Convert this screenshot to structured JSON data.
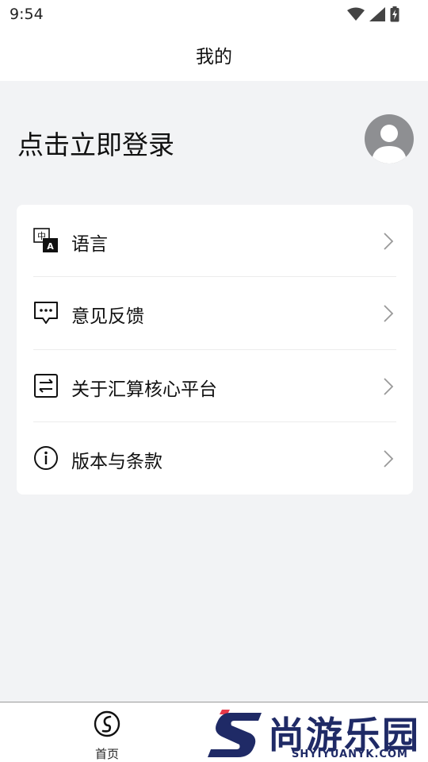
{
  "status_bar": {
    "time": "9:54"
  },
  "header": {
    "title": "我的"
  },
  "login": {
    "prompt": "点击立即登录"
  },
  "menu": {
    "items": [
      {
        "label": "语言",
        "icon": "language-icon"
      },
      {
        "label": "意见反馈",
        "icon": "feedback-icon"
      },
      {
        "label": "关于汇算核心平台",
        "icon": "about-icon"
      },
      {
        "label": "版本与条款",
        "icon": "info-icon"
      }
    ]
  },
  "tabbar": {
    "home_label": "首页"
  },
  "watermark": {
    "name": "尚游乐园",
    "url": "SHYIYUANYK.COM"
  },
  "colors": {
    "background": "#f2f3f5",
    "card": "#ffffff",
    "watermark": "#1f2a66",
    "watermark_accent": "#e8394a"
  }
}
